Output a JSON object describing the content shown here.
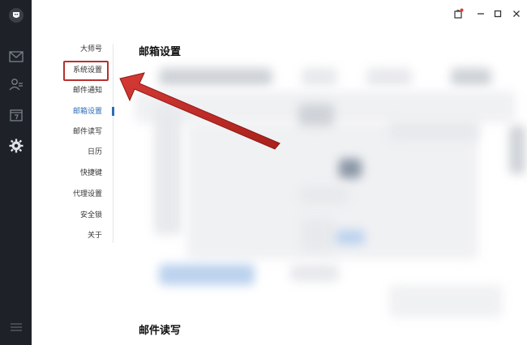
{
  "rail": {
    "items": [
      {
        "name": "logo"
      },
      {
        "name": "mail"
      },
      {
        "name": "contacts"
      },
      {
        "name": "calendar"
      },
      {
        "name": "settings"
      },
      {
        "name": "menu"
      }
    ]
  },
  "nav": {
    "items": [
      {
        "label": "大师号"
      },
      {
        "label": "系统设置"
      },
      {
        "label": "邮件通知"
      },
      {
        "label": "邮箱设置"
      },
      {
        "label": "邮件读写"
      },
      {
        "label": "日历"
      },
      {
        "label": "快捷键"
      },
      {
        "label": "代理设置"
      },
      {
        "label": "安全锁"
      },
      {
        "label": "关于"
      }
    ],
    "active_index": 3
  },
  "main": {
    "section1_title": "邮箱设置",
    "section2_title": "邮件读写"
  },
  "colors": {
    "rail_bg": "#1e2228",
    "accent": "#2b6cb8",
    "highlight": "#b7302d"
  }
}
